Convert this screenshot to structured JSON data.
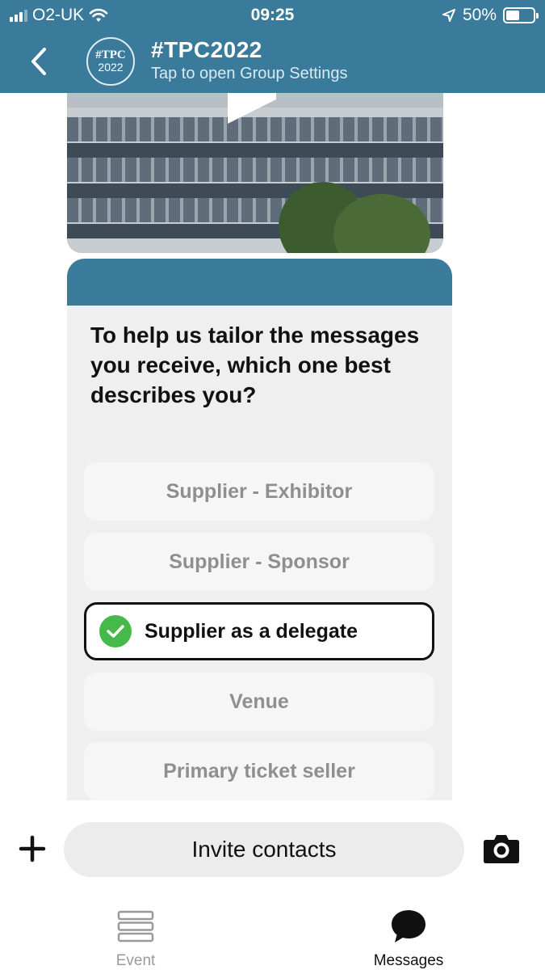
{
  "status_bar": {
    "carrier": "O2-UK",
    "time": "09:25",
    "battery": "50%",
    "battery_level": 0.5
  },
  "header": {
    "logo_line1": "#TPC",
    "logo_line2": "2022",
    "title": "#TPC2022",
    "subtitle": "Tap to open Group Settings"
  },
  "card": {
    "question": "To help us tailor the messages you receive, which one best describes you?",
    "options": [
      {
        "label": "Supplier - Exhibitor",
        "selected": false
      },
      {
        "label": "Supplier - Sponsor",
        "selected": false
      },
      {
        "label": "Supplier as a delegate",
        "selected": true
      },
      {
        "label": "Venue",
        "selected": false
      },
      {
        "label": "Primary ticket seller",
        "selected": false
      }
    ]
  },
  "composer": {
    "invite_label": "Invite contacts"
  },
  "tabs": [
    {
      "label": "Event",
      "icon": "list-icon",
      "active": false
    },
    {
      "label": "Messages",
      "icon": "chat-bubble-icon",
      "active": true
    }
  ],
  "colors": {
    "brand": "#3a7a9b",
    "check": "#45b94a"
  }
}
